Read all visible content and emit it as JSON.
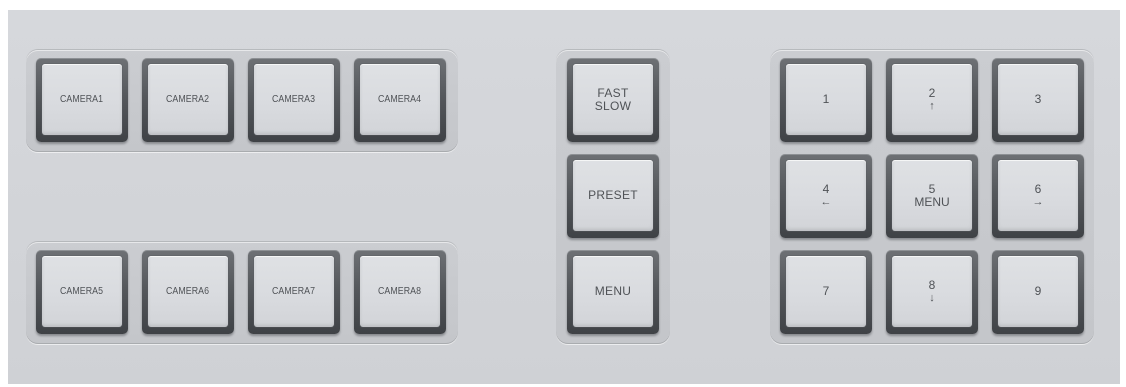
{
  "camera_group_top": [
    {
      "label": "CAMERA1"
    },
    {
      "label": "CAMERA2"
    },
    {
      "label": "CAMERA3"
    },
    {
      "label": "CAMERA4"
    }
  ],
  "camera_group_bottom": [
    {
      "label": "CAMERA5"
    },
    {
      "label": "CAMERA6"
    },
    {
      "label": "CAMERA7"
    },
    {
      "label": "CAMERA8"
    }
  ],
  "function_keys": {
    "fast_slow": {
      "line1": "FAST",
      "line2": "SLOW"
    },
    "preset": {
      "label": "PRESET"
    },
    "menu": {
      "label": "MENU"
    }
  },
  "numpad": [
    {
      "number": "1",
      "sub": ""
    },
    {
      "number": "2",
      "sub": "↑"
    },
    {
      "number": "3",
      "sub": ""
    },
    {
      "number": "4",
      "sub": "←"
    },
    {
      "number": "5",
      "sub": "MENU"
    },
    {
      "number": "6",
      "sub": "→"
    },
    {
      "number": "7",
      "sub": ""
    },
    {
      "number": "8",
      "sub": "↓"
    },
    {
      "number": "9",
      "sub": ""
    }
  ]
}
